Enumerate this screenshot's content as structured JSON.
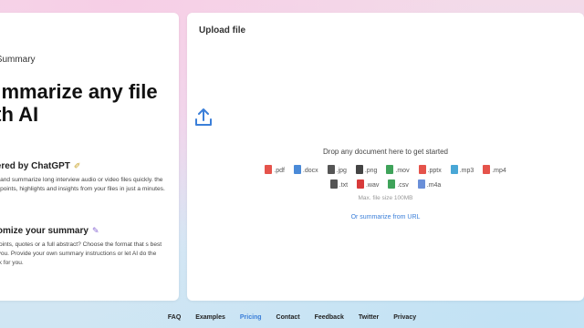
{
  "left": {
    "eyebrow": "y Summary",
    "headline_line1": "ummarize any file",
    "headline_line2": "ith AI",
    "features": [
      {
        "title": "wered by ChatGPT",
        "icon": "magic-wand-icon",
        "text": "yze and summarize long interview audio or video files quickly. the key points, highlights and insights from your files in just a minutes."
      },
      {
        "title": "stomize your summary",
        "icon": "pen-icon",
        "text": "et points, quotes or a full abstract? Choose the format that s best for you. Provide your own summary instructions or let AI do the work for you."
      }
    ]
  },
  "upload": {
    "title": "Upload file",
    "drop_text": "Drop any document here to get started",
    "file_types_row1": [
      {
        "label": ".pdf",
        "color": "#e5534b"
      },
      {
        "label": ".docx",
        "color": "#4a8ad8"
      },
      {
        "label": ".jpg",
        "color": "#555555"
      },
      {
        "label": ".png",
        "color": "#444444"
      },
      {
        "label": ".mov",
        "color": "#3fa35a"
      },
      {
        "label": ".pptx",
        "color": "#e5534b"
      },
      {
        "label": ".mp3",
        "color": "#49a7d6"
      },
      {
        "label": ".mp4",
        "color": "#e5534b"
      }
    ],
    "file_types_row2": [
      {
        "label": ".txt",
        "color": "#555555"
      },
      {
        "label": ".wav",
        "color": "#d83a3a"
      },
      {
        "label": ".csv",
        "color": "#3fa35a"
      },
      {
        "label": ".m4a",
        "color": "#6a8fd8"
      }
    ],
    "max_size": "Max. file size 100MB",
    "url_link": "Or summarize from URL",
    "accent": "#3b7fd9"
  },
  "footer": {
    "links": [
      "FAQ",
      "Examples",
      "Pricing",
      "Contact",
      "Feedback",
      "Twitter",
      "Privacy"
    ],
    "active": "Pricing"
  }
}
